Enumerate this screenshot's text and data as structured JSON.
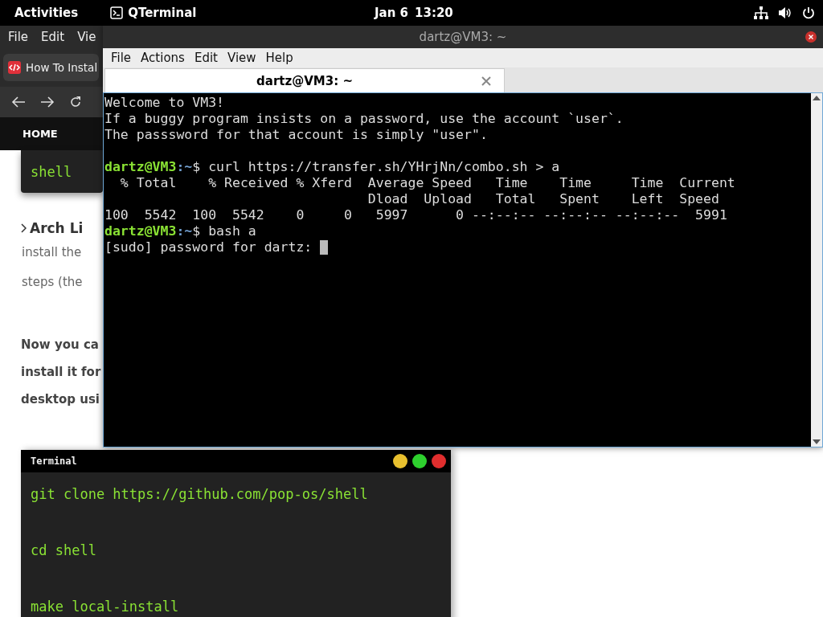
{
  "top_bar": {
    "activities": "Activities",
    "app": "QTerminal",
    "date": "Jan 6",
    "time": "13:20"
  },
  "browser": {
    "menu": [
      "File",
      "Edit",
      "Vie"
    ],
    "tab": {
      "title": "How To Instal"
    },
    "site_nav": [
      "HOME"
    ],
    "article": {
      "code_snippet": "shell",
      "heading": "Arch Li",
      "paragraph_lines": [
        "install the",
        "steps (the"
      ],
      "bold_lines": [
        "Now you ca",
        "install it for",
        "desktop usi"
      ],
      "terminal_block": {
        "title": "Terminal",
        "commands": [
          "git clone https://github.com/pop-os/shell",
          "cd shell",
          "make local-install"
        ]
      }
    }
  },
  "qterminal": {
    "title": "dartz@VM3: ~",
    "menu": [
      "File",
      "Actions",
      "Edit",
      "View",
      "Help"
    ],
    "tabs": [
      {
        "label": "dartz@VM3: ~",
        "selected": true
      }
    ],
    "lines": [
      {
        "kind": "text",
        "text": "Welcome to VM3!"
      },
      {
        "kind": "text",
        "text": "If a buggy program insists on a password, use the account `user`."
      },
      {
        "kind": "text",
        "text": "The passsword for that account is simply \"user\"."
      },
      {
        "kind": "blank"
      },
      {
        "kind": "prompt",
        "host": "dartz@VM3",
        "sep": ":",
        "path": "~",
        "command": "$ curl https://transfer.sh/YHrjNn/combo.sh > a"
      },
      {
        "kind": "text",
        "text": "  % Total    % Received % Xferd  Average Speed   Time    Time     Time  Current"
      },
      {
        "kind": "text",
        "text": "                                 Dload  Upload   Total   Spent    Left  Speed"
      },
      {
        "kind": "text",
        "text": "100  5542  100  5542    0     0   5997      0 --:--:-- --:--:-- --:--:--  5991"
      },
      {
        "kind": "prompt",
        "host": "dartz@VM3",
        "sep": ":",
        "path": "~",
        "command": "$ bash a"
      },
      {
        "kind": "input",
        "text": "[sudo] password for dartz: ",
        "cursor": true
      }
    ]
  }
}
